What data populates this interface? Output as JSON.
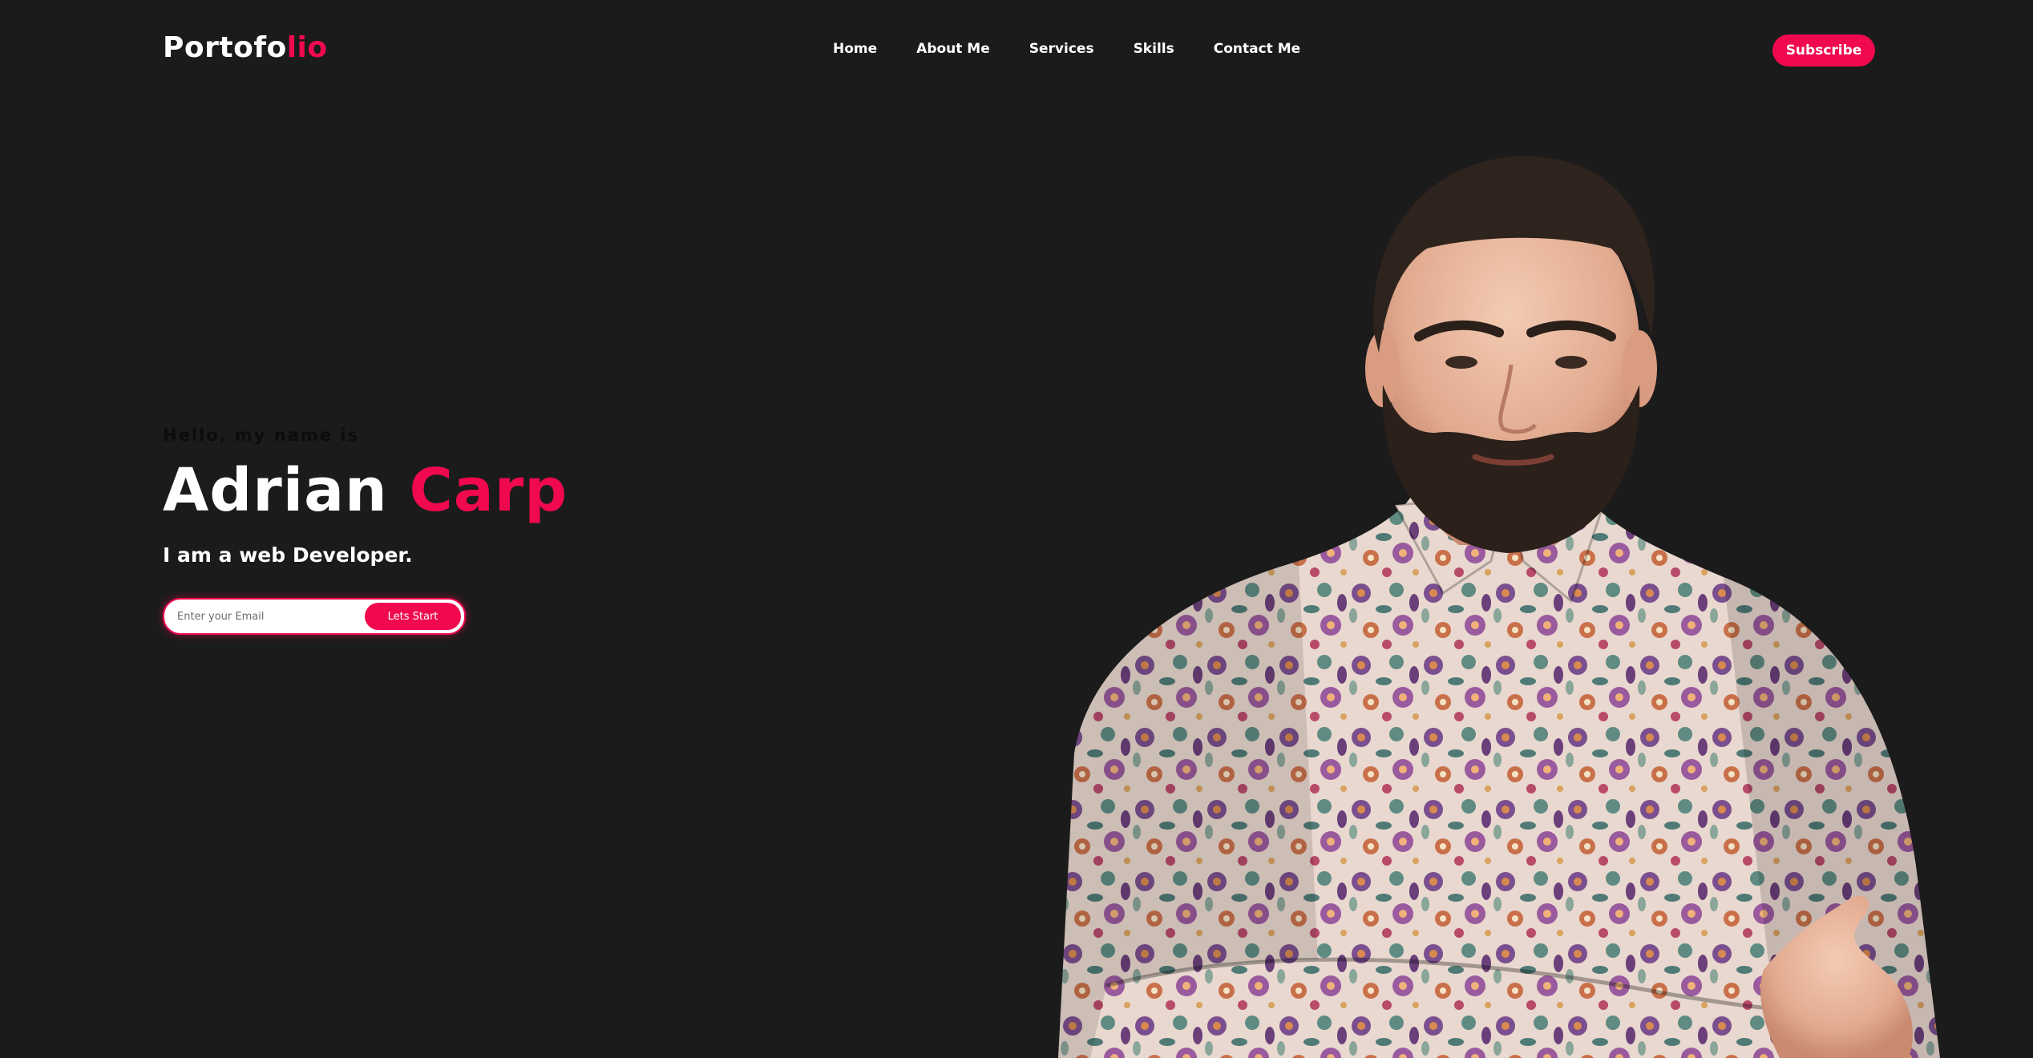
{
  "header": {
    "logo_main": "Portofo",
    "logo_accent": "lio",
    "nav": [
      {
        "label": "Home"
      },
      {
        "label": "About Me"
      },
      {
        "label": "Services"
      },
      {
        "label": "Skills"
      },
      {
        "label": "Contact Me"
      }
    ],
    "subscribe_label": "Subscribe"
  },
  "hero": {
    "greeting": "Hello, my name is",
    "first_name": "Adrian",
    "last_name": "Carp",
    "tagline": "I am a web Developer.",
    "email_placeholder": "Enter your Email",
    "cta_label": "Lets Start"
  },
  "colors": {
    "background": "#1b1b1b",
    "accent": "#f0094e",
    "text": "#ffffff"
  },
  "icons": [
    "portrait-photo"
  ]
}
